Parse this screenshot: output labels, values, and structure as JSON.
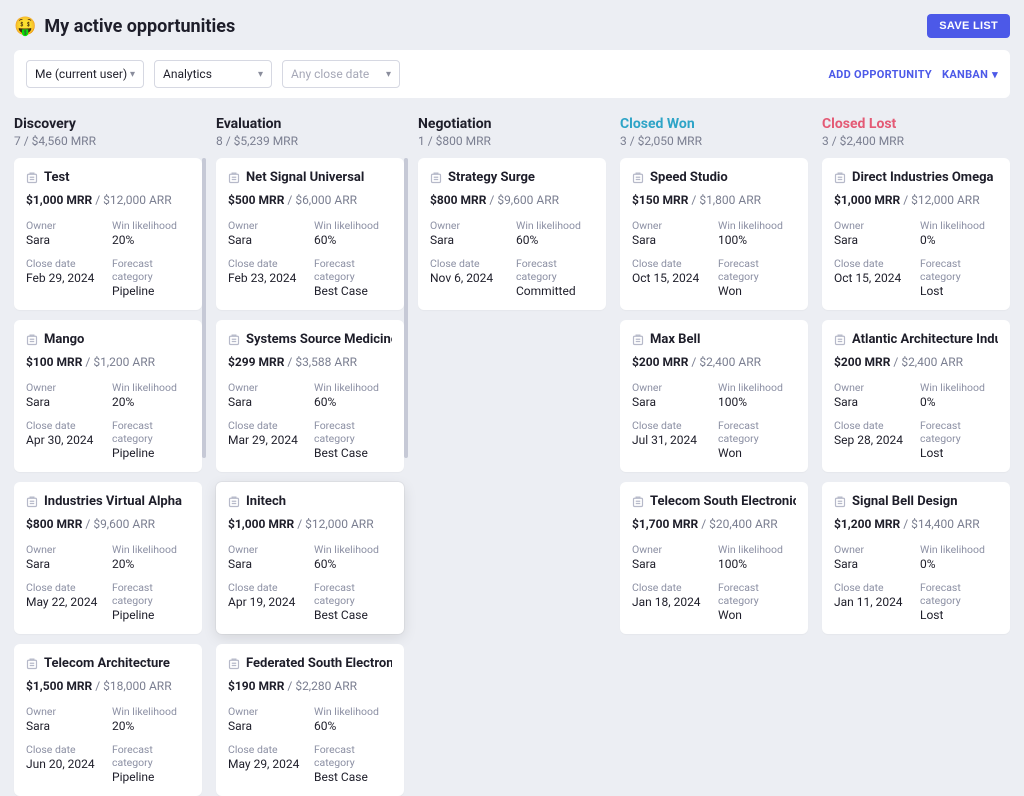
{
  "header": {
    "emoji": "🤑",
    "title": "My active opportunities",
    "save_label": "SAVE LIST"
  },
  "filters": {
    "owner": "Me (current user)",
    "segment": "Analytics",
    "date_placeholder": "Any close date",
    "add_label": "ADD OPPORTUNITY",
    "kanban_label": "KANBAN"
  },
  "labels": {
    "owner": "Owner",
    "win": "Win likelihood",
    "close": "Close date",
    "forecast": "Forecast category"
  },
  "columns": [
    {
      "id": "discovery",
      "title": "Discovery",
      "sub": "7 / $4,560 MRR",
      "scroll": true,
      "cards": [
        {
          "name": "Test",
          "mrr": "$1,000 MRR",
          "arr": "$12,000 ARR",
          "owner": "Sara",
          "win": "20%",
          "close": "Feb 29, 2024",
          "forecast": "Pipeline"
        },
        {
          "name": "Mango",
          "mrr": "$100 MRR",
          "arr": "$1,200 ARR",
          "owner": "Sara",
          "win": "20%",
          "close": "Apr 30, 2024",
          "forecast": "Pipeline"
        },
        {
          "name": "Industries Virtual Alpha",
          "mrr": "$800 MRR",
          "arr": "$9,600 ARR",
          "owner": "Sara",
          "win": "20%",
          "close": "May 22, 2024",
          "forecast": "Pipeline"
        },
        {
          "name": "Telecom Architecture",
          "mrr": "$1,500 MRR",
          "arr": "$18,000 ARR",
          "owner": "Sara",
          "win": "20%",
          "close": "Jun 20, 2024",
          "forecast": "Pipeline"
        }
      ]
    },
    {
      "id": "evaluation",
      "title": "Evaluation",
      "sub": "8 / $5,239 MRR",
      "scroll": true,
      "cards": [
        {
          "name": "Net Signal Universal",
          "mrr": "$500 MRR",
          "arr": "$6,000 ARR",
          "owner": "Sara",
          "win": "60%",
          "close": "Feb 23, 2024",
          "forecast": "Best Case"
        },
        {
          "name": "Systems Source Medicine",
          "mrr": "$299 MRR",
          "arr": "$3,588 ARR",
          "owner": "Sara",
          "win": "60%",
          "close": "Mar 29, 2024",
          "forecast": "Best Case"
        },
        {
          "name": "Initech",
          "mrr": "$1,000 MRR",
          "arr": "$12,000 ARR",
          "owner": "Sara",
          "win": "60%",
          "close": "Apr 19, 2024",
          "forecast": "Best Case",
          "active": true
        },
        {
          "name": "Federated South Electronic",
          "mrr": "$190 MRR",
          "arr": "$2,280 ARR",
          "owner": "Sara",
          "win": "60%",
          "close": "May 29, 2024",
          "forecast": "Best Case"
        }
      ]
    },
    {
      "id": "negotiation",
      "title": "Negotiation",
      "sub": "1 / $800 MRR",
      "cards": [
        {
          "name": "Strategy Surge",
          "mrr": "$800 MRR",
          "arr": "$9,600 ARR",
          "owner": "Sara",
          "win": "60%",
          "close": "Nov 6, 2024",
          "forecast": "Committed"
        }
      ]
    },
    {
      "id": "won",
      "title": "Closed Won",
      "sub": "3 / $2,050 MRR",
      "style": "won",
      "cards": [
        {
          "name": "Speed Studio",
          "mrr": "$150 MRR",
          "arr": "$1,800 ARR",
          "owner": "Sara",
          "win": "100%",
          "close": "Oct 15, 2024",
          "forecast": "Won"
        },
        {
          "name": "Max Bell",
          "mrr": "$200 MRR",
          "arr": "$2,400 ARR",
          "owner": "Sara",
          "win": "100%",
          "close": "Jul 31, 2024",
          "forecast": "Won"
        },
        {
          "name": "Telecom South Electronics",
          "mrr": "$1,700 MRR",
          "arr": "$20,400 ARR",
          "owner": "Sara",
          "win": "100%",
          "close": "Jan 18, 2024",
          "forecast": "Won"
        }
      ]
    },
    {
      "id": "lost",
      "title": "Closed Lost",
      "sub": "3 / $2,400 MRR",
      "style": "lost",
      "cards": [
        {
          "name": "Direct Industries Omega",
          "mrr": "$1,000 MRR",
          "arr": "$12,000 ARR",
          "owner": "Sara",
          "win": "0%",
          "close": "Oct 15, 2024",
          "forecast": "Lost"
        },
        {
          "name": "Atlantic Architecture Indust…",
          "mrr": "$200 MRR",
          "arr": "$2,400 ARR",
          "owner": "Sara",
          "win": "0%",
          "close": "Sep 28, 2024",
          "forecast": "Lost"
        },
        {
          "name": "Signal Bell Design",
          "mrr": "$1,200 MRR",
          "arr": "$14,400 ARR",
          "owner": "Sara",
          "win": "0%",
          "close": "Jan 11, 2024",
          "forecast": "Lost"
        }
      ]
    }
  ]
}
